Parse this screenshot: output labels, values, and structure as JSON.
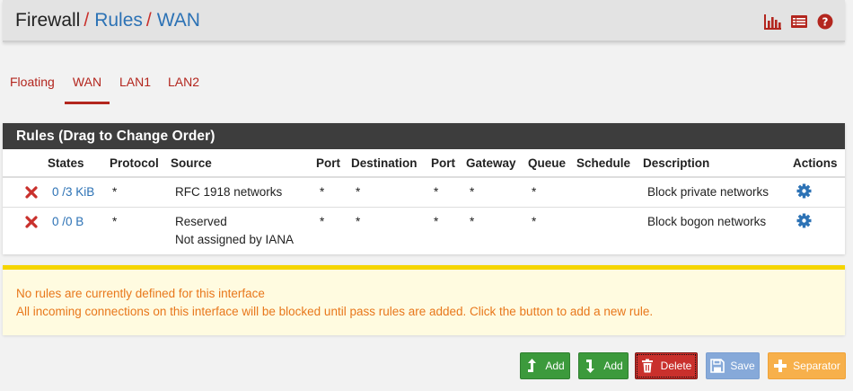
{
  "breadcrumb": {
    "first": "Firewall",
    "second": "Rules",
    "third": "WAN",
    "separator": "/"
  },
  "header_icons": [
    "bar-chart-icon",
    "list-icon",
    "help-icon"
  ],
  "tabs": [
    {
      "label": "Floating",
      "active": false
    },
    {
      "label": "WAN",
      "active": true
    },
    {
      "label": "LAN1",
      "active": false
    },
    {
      "label": "LAN2",
      "active": false
    }
  ],
  "panel": {
    "title": "Rules (Drag to Change Order)",
    "columns": [
      "States",
      "Protocol",
      "Source",
      "Port",
      "Destination",
      "Port",
      "Gateway",
      "Queue",
      "Schedule",
      "Description",
      "Actions"
    ],
    "rows": [
      {
        "states": "0 /3 KiB",
        "protocol": "*",
        "source": "RFC 1918 networks",
        "source_sub": "",
        "port": "*",
        "destination": "*",
        "dest_port": "*",
        "gateway": "*",
        "queue": "*",
        "schedule": "",
        "description": "Block private networks"
      },
      {
        "states": "0 /0 B",
        "protocol": "*",
        "source": "Reserved",
        "source_sub": "Not assigned by IANA",
        "port": "*",
        "destination": "*",
        "dest_port": "*",
        "gateway": "*",
        "queue": "*",
        "schedule": "",
        "description": "Block bogon networks"
      }
    ]
  },
  "notice": {
    "line1": "No rules are currently defined for this interface",
    "line2": "All incoming connections on this interface will be blocked until pass rules are added. Click the button to add a new rule."
  },
  "buttons": {
    "add_top": "Add",
    "add_bottom": "Add",
    "delete": "Delete",
    "save": "Save",
    "separator": "Separator"
  },
  "colors": {
    "accent_red": "#b3261e",
    "link_blue": "#2c72b5",
    "notice_text": "#e8771b",
    "button_green": "#3c9a3c",
    "button_blue": "#86a9d9",
    "button_orange": "#f7b04b"
  }
}
